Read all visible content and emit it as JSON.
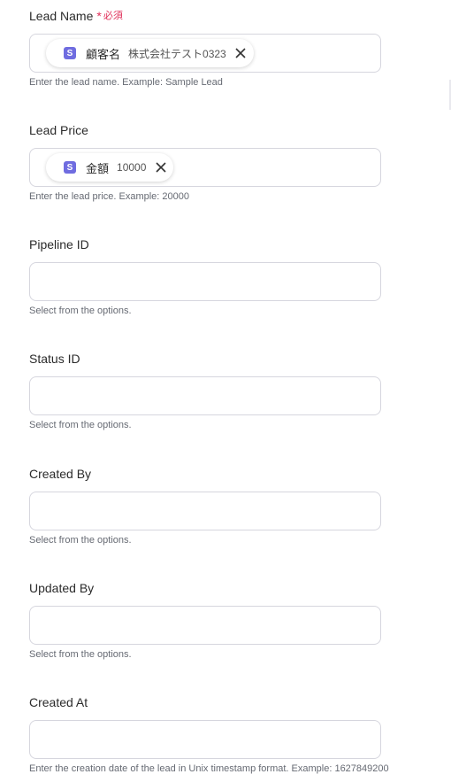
{
  "fields": [
    {
      "label": "Lead Name",
      "required_mark": "*",
      "required_text": "必須",
      "chip": {
        "icon": "S",
        "name": "顧客名",
        "value": "株式会社テスト0323"
      },
      "help": "Enter the lead name. Example: Sample Lead"
    },
    {
      "label": "Lead Price",
      "chip": {
        "icon": "S",
        "name": "金額",
        "value": "10000"
      },
      "help": "Enter the lead price. Example: 20000"
    },
    {
      "label": "Pipeline ID",
      "help": "Select from the options."
    },
    {
      "label": "Status ID",
      "help": "Select from the options."
    },
    {
      "label": "Created By",
      "help": "Select from the options."
    },
    {
      "label": "Updated By",
      "help": "Select from the options."
    },
    {
      "label": "Created At",
      "help": "Enter the creation date of the lead in Unix timestamp format. Example: 1627849200"
    }
  ],
  "colors": {
    "required": "#e0305a",
    "chip_icon": "#6f6ce0",
    "border": "#d6d6de"
  },
  "icons": {
    "chip_close": "close-icon",
    "chip_source": "s-badge-icon"
  }
}
